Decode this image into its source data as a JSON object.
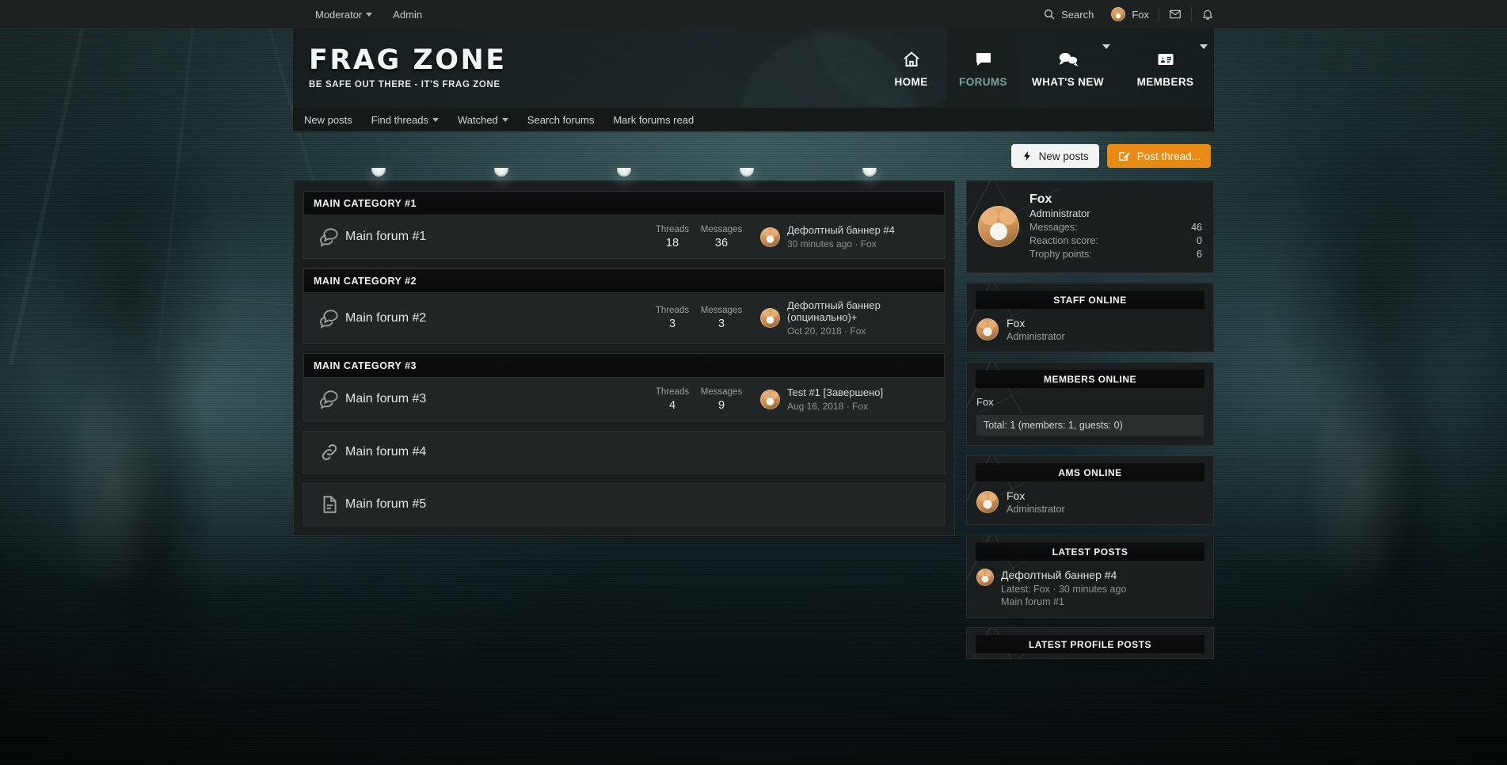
{
  "topbar": {
    "left_items": [
      {
        "label": "Moderator",
        "caret": true,
        "name": "moderator"
      },
      {
        "label": "Admin",
        "caret": false,
        "name": "admin"
      }
    ],
    "search_label": "Search",
    "user_label": "Fox",
    "icons": {
      "search": "search-icon",
      "mail": "mail-icon",
      "bell": "bell-icon",
      "avatar": "avatar"
    }
  },
  "logo": {
    "title": "FRAG ZONE",
    "tagline": "BE SAFE OUT THERE - IT'S FRAG ZONE"
  },
  "mainnav": {
    "items": [
      {
        "label": "HOME",
        "icon": "home-icon",
        "active": false,
        "caret": false
      },
      {
        "label": "FORUMS",
        "icon": "speech-bubble-icon",
        "active": true,
        "caret": false
      },
      {
        "label": "WHAT'S NEW",
        "icon": "chat-bubbles-icon",
        "active": false,
        "caret": true
      },
      {
        "label": "MEMBERS",
        "icon": "id-card-icon",
        "active": false,
        "caret": true
      }
    ]
  },
  "subnav": {
    "items": [
      {
        "label": "New posts",
        "caret": false
      },
      {
        "label": "Find threads",
        "caret": true
      },
      {
        "label": "Watched",
        "caret": true
      },
      {
        "label": "Search forums",
        "caret": false
      },
      {
        "label": "Mark forums read",
        "caret": false
      }
    ]
  },
  "actions": {
    "new_posts_label": "New posts",
    "post_thread_label": "Post thread...",
    "accent_color": "#e98b12"
  },
  "forum_list": {
    "labels": {
      "threads": "Threads",
      "messages": "Messages"
    },
    "categories": [
      {
        "title": "MAIN CATEGORY #1",
        "forums": [
          {
            "name": "Main forum #1",
            "icon": "speech-bubbles-icon",
            "threads": "18",
            "messages": "36",
            "last_post_title": "Дефолтный баннер #4",
            "last_post_meta": "30 minutes ago · Fox"
          }
        ]
      },
      {
        "title": "MAIN CATEGORY #2",
        "forums": [
          {
            "name": "Main forum #2",
            "icon": "speech-bubbles-icon",
            "threads": "3",
            "messages": "3",
            "last_post_title": "Дефолтный баннер (опцинально)+",
            "last_post_meta": "Oct 20, 2018 · Fox"
          }
        ]
      },
      {
        "title": "MAIN CATEGORY #3",
        "forums": [
          {
            "name": "Main forum #3",
            "icon": "speech-bubbles-icon",
            "threads": "4",
            "messages": "9",
            "last_post_title": "Test #1 [Завершено]",
            "last_post_meta": "Aug 16, 2018 · Fox"
          }
        ]
      }
    ],
    "standalone": [
      {
        "name": "Main forum #4",
        "icon": "link-icon"
      },
      {
        "name": "Main forum #5",
        "icon": "document-icon"
      }
    ]
  },
  "sidebar": {
    "profile": {
      "name": "Fox",
      "role": "Administrator",
      "stats": [
        {
          "key": "Messages:",
          "value": "46"
        },
        {
          "key": "Reaction score:",
          "value": "0"
        },
        {
          "key": "Trophy points:",
          "value": "6"
        }
      ]
    },
    "staff_online": {
      "title": "STAFF ONLINE",
      "members": [
        {
          "name": "Fox",
          "role": "Administrator"
        }
      ]
    },
    "members_online": {
      "title": "MEMBERS ONLINE",
      "members": [
        {
          "name": "Fox"
        }
      ],
      "total": "Total: 1 (members: 1, guests: 0)"
    },
    "ams_online": {
      "title": "AMS ONLINE",
      "members": [
        {
          "name": "Fox",
          "role": "Administrator"
        }
      ]
    },
    "latest_posts": {
      "title": "LATEST POSTS",
      "items": [
        {
          "title": "Дефолтный баннер #4",
          "meta": "Latest: Fox · 30 minutes ago",
          "forum": "Main forum #1"
        }
      ]
    },
    "latest_profile_posts": {
      "title": "LATEST PROFILE POSTS"
    }
  }
}
